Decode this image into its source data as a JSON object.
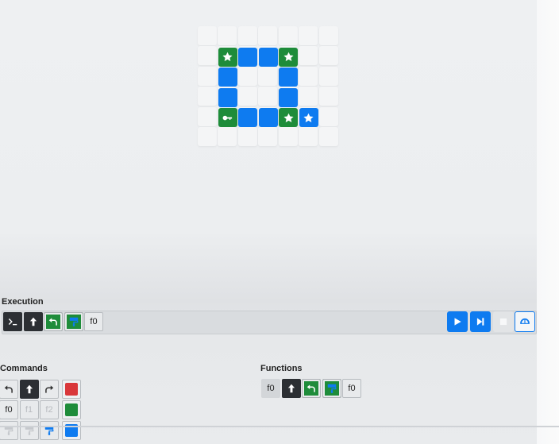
{
  "board": {
    "tiles": [
      {
        "col": 1,
        "row": 1,
        "color": "green",
        "icon": "star-icon"
      },
      {
        "col": 2,
        "row": 1,
        "color": "blue",
        "icon": ""
      },
      {
        "col": 3,
        "row": 1,
        "color": "blue",
        "icon": ""
      },
      {
        "col": 4,
        "row": 1,
        "color": "green",
        "icon": "star-icon"
      },
      {
        "col": 1,
        "row": 2,
        "color": "blue",
        "icon": ""
      },
      {
        "col": 4,
        "row": 2,
        "color": "blue",
        "icon": ""
      },
      {
        "col": 1,
        "row": 3,
        "color": "blue",
        "icon": ""
      },
      {
        "col": 4,
        "row": 3,
        "color": "blue",
        "icon": ""
      },
      {
        "col": 1,
        "row": 4,
        "color": "green",
        "icon": "robot-arrow-icon"
      },
      {
        "col": 2,
        "row": 4,
        "color": "blue",
        "icon": ""
      },
      {
        "col": 3,
        "row": 4,
        "color": "blue",
        "icon": ""
      },
      {
        "col": 4,
        "row": 4,
        "color": "green",
        "icon": "star-icon"
      },
      {
        "col": 5,
        "row": 4,
        "color": "blue",
        "icon": "star-icon"
      }
    ]
  },
  "colors": {
    "blue": "#0e7bf0",
    "green": "#1e8c3a",
    "red": "#d9373a",
    "dark": "#2c2f33"
  },
  "execution": {
    "label": "Execution",
    "steps": [
      {
        "icon": "terminal-icon",
        "dark": true
      },
      {
        "icon": "forward-arrow-icon",
        "dark": true
      },
      {
        "icon": "turn-left-icon",
        "color": "green"
      },
      {
        "icon": "paint-icon",
        "color": "green"
      },
      {
        "text": "f0"
      }
    ],
    "controls": [
      "play-button",
      "step-button",
      "stop-button",
      "speed-button"
    ]
  },
  "commands": {
    "label": "Commands",
    "rows": [
      [
        {
          "icon": "turn-left-icon"
        },
        {
          "icon": "forward-arrow-icon",
          "dark": true
        },
        {
          "icon": "turn-right-icon"
        }
      ],
      [
        {
          "text": "f0"
        },
        {
          "text": "f1",
          "disabled": true
        },
        {
          "text": "f2",
          "disabled": true
        }
      ],
      [
        {
          "icon": "paint-icon",
          "disabled": true,
          "hue": "gray"
        },
        {
          "icon": "paint-icon",
          "disabled": true,
          "hue": "gray"
        },
        {
          "icon": "paint-icon",
          "hue": "blue"
        }
      ]
    ],
    "swatches": [
      "red",
      "green",
      "blue"
    ]
  },
  "functions": {
    "label": "Functions",
    "items": [
      {
        "text": "f0",
        "header": true
      },
      {
        "icon": "forward-arrow-icon",
        "dark": true
      },
      {
        "icon": "turn-left-icon",
        "color": "green"
      },
      {
        "icon": "paint-icon",
        "color": "green"
      },
      {
        "text": "f0"
      }
    ]
  }
}
